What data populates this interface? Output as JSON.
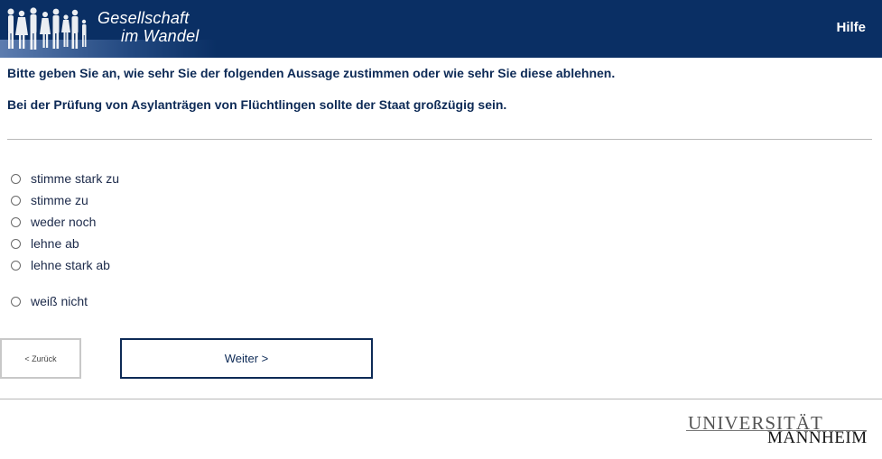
{
  "header": {
    "logo_line1": "Gesellschaft",
    "logo_line2": "im Wandel",
    "help_label": "Hilfe",
    "background_color": "#0a2f64"
  },
  "question": {
    "intro": "Bitte geben Sie an, wie sehr Sie der folgenden Aussage zustimmen oder wie sehr Sie diese ablehnen.",
    "statement": "Bei der Prüfung von Asylanträgen von Flüchtlingen sollte der Staat großzügig sein."
  },
  "options": [
    {
      "label": "stimme stark zu",
      "selected": false
    },
    {
      "label": "stimme zu",
      "selected": false
    },
    {
      "label": "weder noch",
      "selected": false
    },
    {
      "label": "lehne ab",
      "selected": false
    },
    {
      "label": "lehne stark ab",
      "selected": false
    },
    {
      "label": "weiß nicht",
      "selected": false
    }
  ],
  "navigation": {
    "back_label": "< Zurück",
    "next_label": "Weiter >"
  },
  "footer": {
    "university_line1": "UNIVERSITÄT",
    "university_line2": "MANNHEIM"
  }
}
